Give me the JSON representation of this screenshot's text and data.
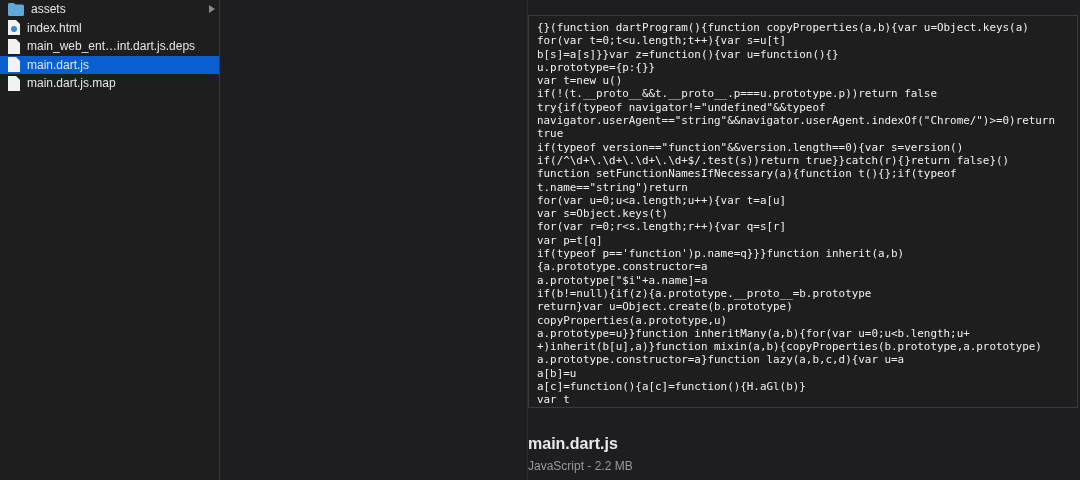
{
  "file_list": [
    {
      "name": "assets",
      "kind": "folder",
      "selected": false
    },
    {
      "name": "index.html",
      "kind": "html",
      "selected": false
    },
    {
      "name": "main_web_ent…int.dart.js.deps",
      "kind": "file",
      "selected": false
    },
    {
      "name": "main.dart.js",
      "kind": "file",
      "selected": true
    },
    {
      "name": "main.dart.js.map",
      "kind": "file",
      "selected": false
    }
  ],
  "preview": {
    "code_lines": [
      "{}(function dartProgram(){function copyProperties(a,b){var u=Object.keys(a)",
      "for(var t=0;t<u.length;t++){var s=u[t]",
      "b[s]=a[s]}}var z=function(){var u=function(){}",
      "u.prototype={p:{}}",
      "var t=new u()",
      "if(!(t.__proto__&&t.__proto__.p===u.prototype.p))return false",
      "try{if(typeof navigator!=\"undefined\"&&typeof",
      "navigator.userAgent==\"string\"&&navigator.userAgent.indexOf(\"Chrome/\")>=0)return",
      "true",
      "if(typeof version==\"function\"&&version.length==0){var s=version()",
      "if(/^\\d+\\.\\d+\\.\\d+\\.\\d+$/.test(s))return true}}catch(r){}return false}()",
      "function setFunctionNamesIfNecessary(a){function t(){};if(typeof",
      "t.name==\"string\")return",
      "for(var u=0;u<a.length;u++){var t=a[u]",
      "var s=Object.keys(t)",
      "for(var r=0;r<s.length;r++){var q=s[r]",
      "var p=t[q]",
      "if(typeof p=='function')p.name=q}}}function inherit(a,b)",
      "{a.prototype.constructor=a",
      "a.prototype[\"$i\"+a.name]=a",
      "if(b!=null){if(z){a.prototype.__proto__=b.prototype",
      "return}var u=Object.create(b.prototype)",
      "copyProperties(a.prototype,u)",
      "a.prototype=u}}function inheritMany(a,b){for(var u=0;u<b.length;u+",
      "+)inherit(b[u],a)}function mixin(a,b){copyProperties(b.prototype,a.prototype)",
      "a.prototype.constructor=a}function lazy(a,b,c,d){var u=a",
      "a[b]=u",
      "a[c]=function(){a[c]=function(){H.aGl(b)}",
      "var t"
    ],
    "file_name": "main.dart.js",
    "file_info": "JavaScript - 2.2 MB"
  }
}
